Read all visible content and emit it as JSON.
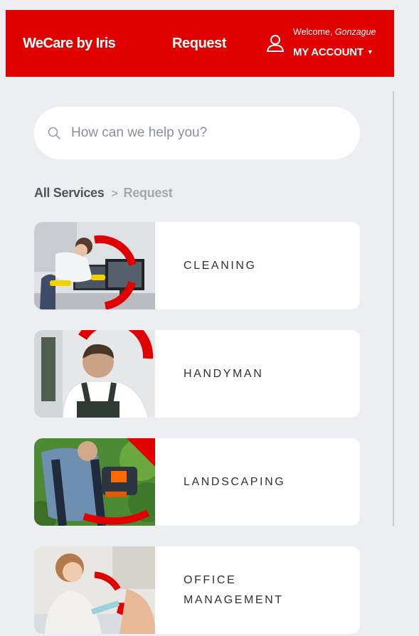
{
  "header": {
    "brand": "WeCare by Iris",
    "nav_request": "Request",
    "welcome_prefix": "Welcome, ",
    "user_name": "Gonzague",
    "my_account": "MY ACCOUNT",
    "caret": "▼"
  },
  "search": {
    "placeholder": "How can we help you?",
    "value": ""
  },
  "breadcrumb": {
    "all": "All Services",
    "separator": ">",
    "current": "Request"
  },
  "services": [
    {
      "label": "CLEANING",
      "icon": "cleaning-photo"
    },
    {
      "label": "HANDYMAN",
      "icon": "handyman-photo"
    },
    {
      "label": "LANDSCAPING",
      "icon": "landscaping-photo"
    },
    {
      "label": "OFFICE\nMANAGEMENT",
      "icon": "office-management-photo"
    }
  ],
  "colors": {
    "brand_red": "#e00000",
    "page_bg": "#eceef1",
    "card_bg": "#ffffff"
  }
}
